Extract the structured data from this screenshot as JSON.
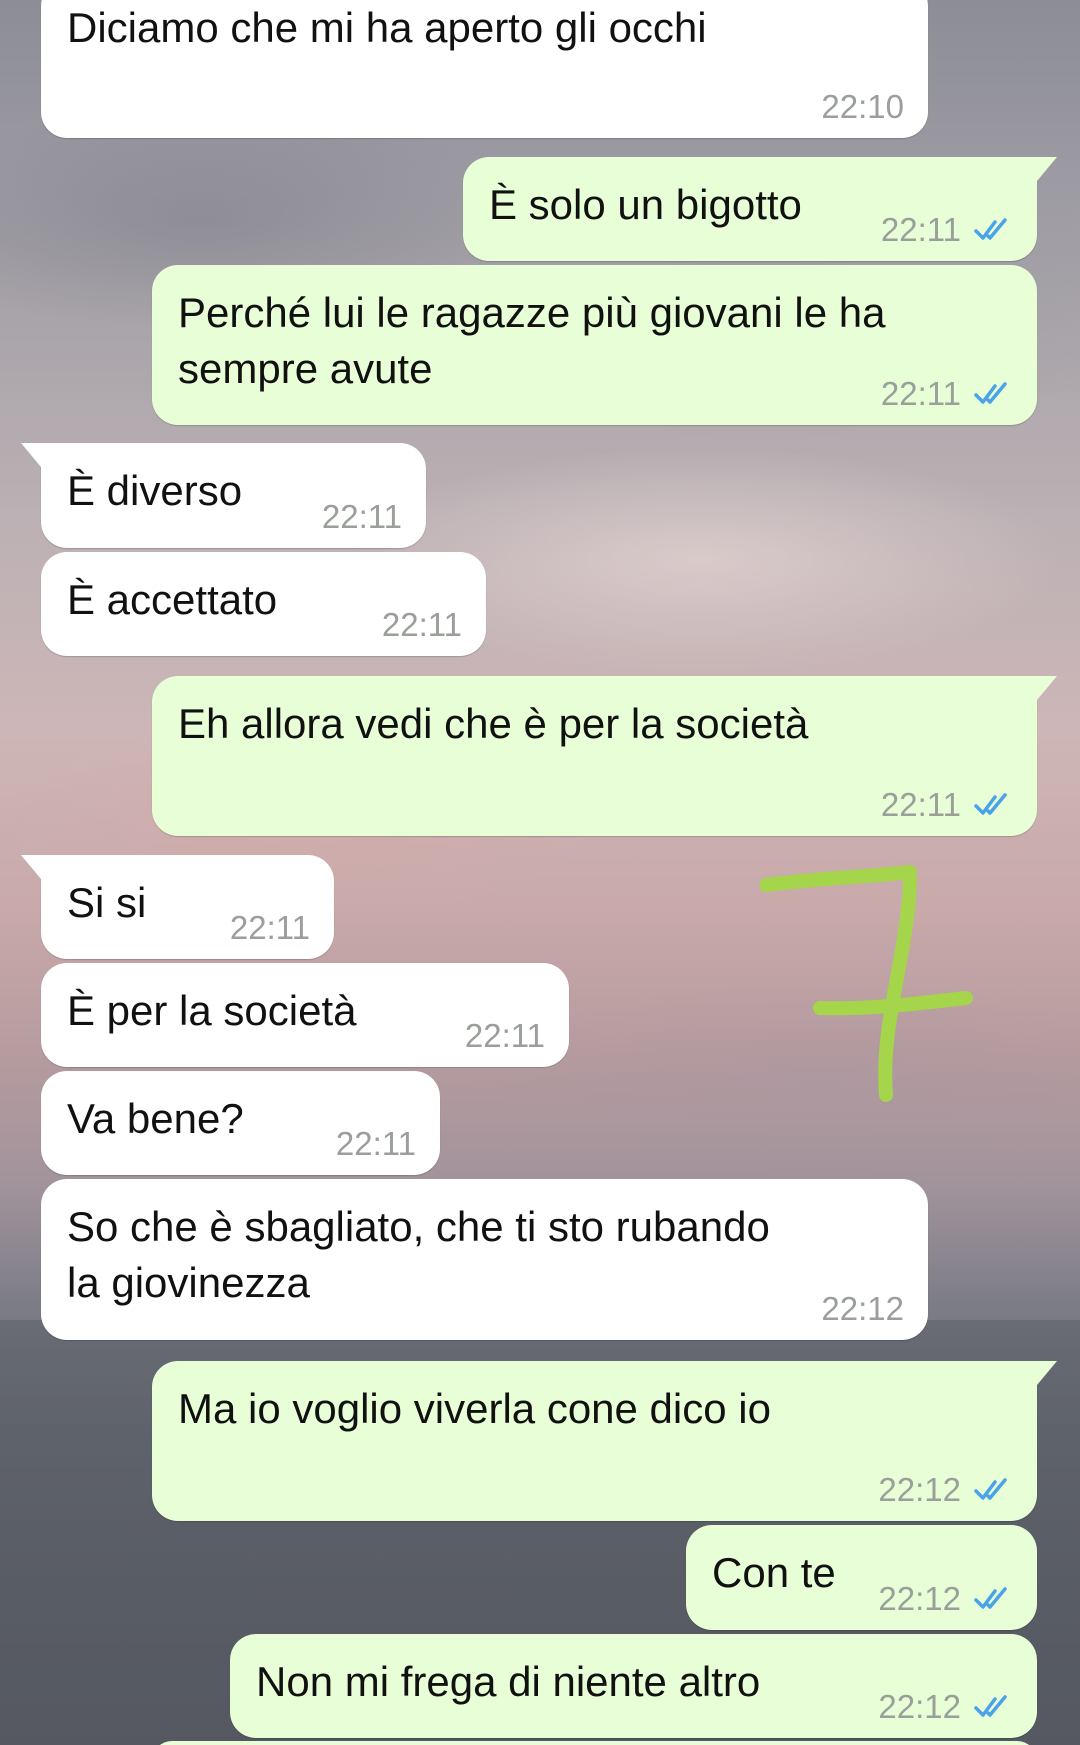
{
  "colors": {
    "incoming_bubble": "#ffffff",
    "outgoing_bubble": "#e7fed7",
    "timestamp": "#9a9f9a",
    "read_ticks": "#4aa3e8",
    "annotation": "#a4d54a"
  },
  "messages": [
    {
      "text": "Diciamo che mi ha aperto gli occhi",
      "time": "22:10"
    },
    {
      "text": "È solo un bigotto",
      "time": "22:11",
      "status_icon": "double-check-read-icon"
    },
    {
      "line1": "Perché lui le ragazze più giovani le ha",
      "line2": "sempre avute",
      "time": "22:11",
      "status_icon": "double-check-read-icon"
    },
    {
      "text": "È diverso",
      "time": "22:11"
    },
    {
      "text": "È accettato",
      "time": "22:11"
    },
    {
      "text": "Eh allora vedi che è per la società",
      "time": "22:11",
      "status_icon": "double-check-read-icon"
    },
    {
      "text": "Si si",
      "time": "22:11"
    },
    {
      "text": "È per la società",
      "time": "22:11"
    },
    {
      "text": "Va bene?",
      "time": "22:11"
    },
    {
      "line1": "So che è sbagliato, che ti sto rubando",
      "line2": "la giovinezza",
      "time": "22:12"
    },
    {
      "text": "Ma io voglio viverla cone dico io",
      "time": "22:12",
      "status_icon": "double-check-read-icon"
    },
    {
      "text": "Con te",
      "time": "22:12",
      "status_icon": "double-check-read-icon"
    },
    {
      "text": "Non mi frega di niente altro",
      "time": "22:12",
      "status_icon": "double-check-read-icon"
    }
  ],
  "annotation": {
    "icon": "handwritten-seven-mark"
  }
}
